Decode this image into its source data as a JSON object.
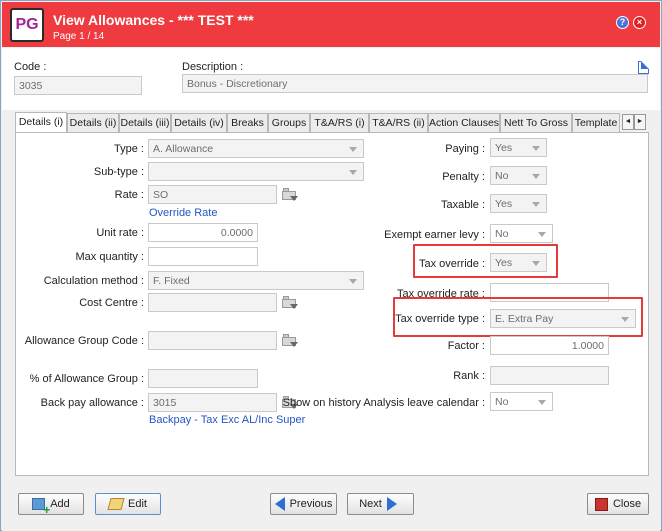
{
  "app": {
    "logo": "PG",
    "title": "View Allowances - *** TEST ***",
    "page_info": "Page 1 / 14"
  },
  "header": {
    "code_label": "Code :",
    "code_value": "3035",
    "description_label": "Description :",
    "description_value": "Bonus - Discretionary"
  },
  "tabs": [
    "Details (i)",
    "Details (ii)",
    "Details (iii)",
    "Details (iv)",
    "Breaks",
    "Groups",
    "T&A/RS (i)",
    "T&A/RS (ii)",
    "Action Clauses",
    "Nett To Gross",
    "Template"
  ],
  "tab_nav": {
    "left": "◄",
    "right": "►"
  },
  "left": {
    "type_label": "Type :",
    "type_value": "A. Allowance",
    "subtype_label": "Sub-type :",
    "subtype_value": "",
    "rate_label": "Rate :",
    "rate_value": "SO",
    "override_rate_link": "Override Rate",
    "unit_rate_label": "Unit rate :",
    "unit_rate_value": "0.0000",
    "max_qty_label": "Max quantity :",
    "max_qty_value": "",
    "calc_method_label": "Calculation method :",
    "calc_method_value": "F. Fixed",
    "cost_centre_label": "Cost Centre :",
    "cost_centre_value": "",
    "allow_group_code_label": "Allowance Group Code :",
    "allow_group_code_value": "",
    "pct_allow_group_label": "% of Allowance Group :",
    "pct_allow_group_value": "",
    "back_pay_label": "Back pay allowance :",
    "back_pay_value": "3015",
    "back_pay_link": "Backpay - Tax Exc AL/Inc Super"
  },
  "right": {
    "paying_label": "Paying :",
    "paying_value": "Yes",
    "penalty_label": "Penalty :",
    "penalty_value": "No",
    "taxable_label": "Taxable :",
    "taxable_value": "Yes",
    "exempt_label": "Exempt earner levy :",
    "exempt_value": "No",
    "tax_override_label": "Tax override :",
    "tax_override_value": "Yes",
    "tax_override_rate_label": "Tax override rate :",
    "tax_override_rate_value": "",
    "tax_override_type_label": "Tax override type :",
    "tax_override_type_value": "E. Extra Pay",
    "factor_label": "Factor :",
    "factor_value": "1.0000",
    "rank_label": "Rank :",
    "rank_value": "",
    "show_history_label": "Show on history Analysis leave calendar :",
    "show_history_value": "No"
  },
  "buttons": {
    "add": "Add",
    "edit": "Edit",
    "previous": "Previous",
    "next": "Next",
    "close": "Close"
  },
  "colors": {
    "titlebar": "#ef3b3f",
    "highlight": "#e33b3b",
    "link": "#2456c5"
  }
}
